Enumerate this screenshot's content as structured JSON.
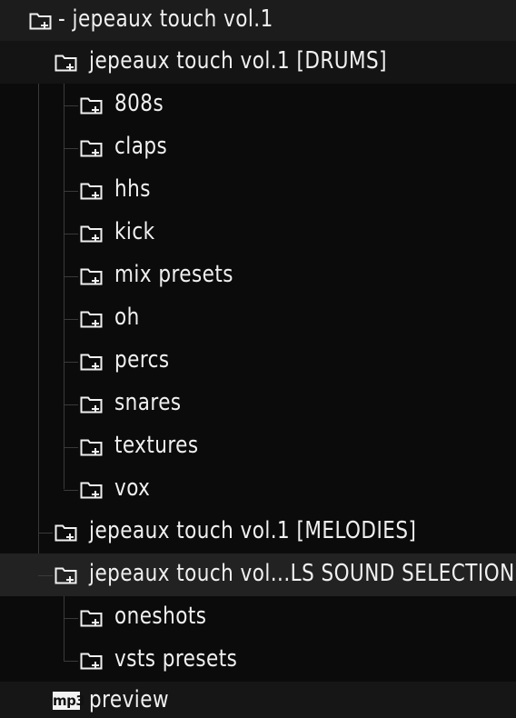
{
  "tree": {
    "root": {
      "label": "- jepeaux touch vol.1",
      "icon": "folder-icon"
    },
    "drums": {
      "label": "jepeaux touch vol.1 [DRUMS]",
      "icon": "folder-icon",
      "children": [
        "808s",
        "claps",
        "hhs",
        "kick",
        "mix presets",
        "oh",
        "percs",
        "snares",
        "textures",
        "vox"
      ]
    },
    "melodies": {
      "label": "jepeaux touch vol.1 [MELODIES]",
      "icon": "folder-icon"
    },
    "sound_selection": {
      "label": "jepeaux touch vol...LS SOUND SELECTION]",
      "icon": "folder-icon",
      "children": [
        "oneshots",
        "vsts presets"
      ]
    },
    "preview": {
      "label": "preview",
      "badge": "mp3",
      "icon": "mp3-file-icon"
    }
  },
  "colors": {
    "background": "#0b0b0b",
    "text": "#f0f0f0",
    "guide": "#3a3a3a"
  }
}
